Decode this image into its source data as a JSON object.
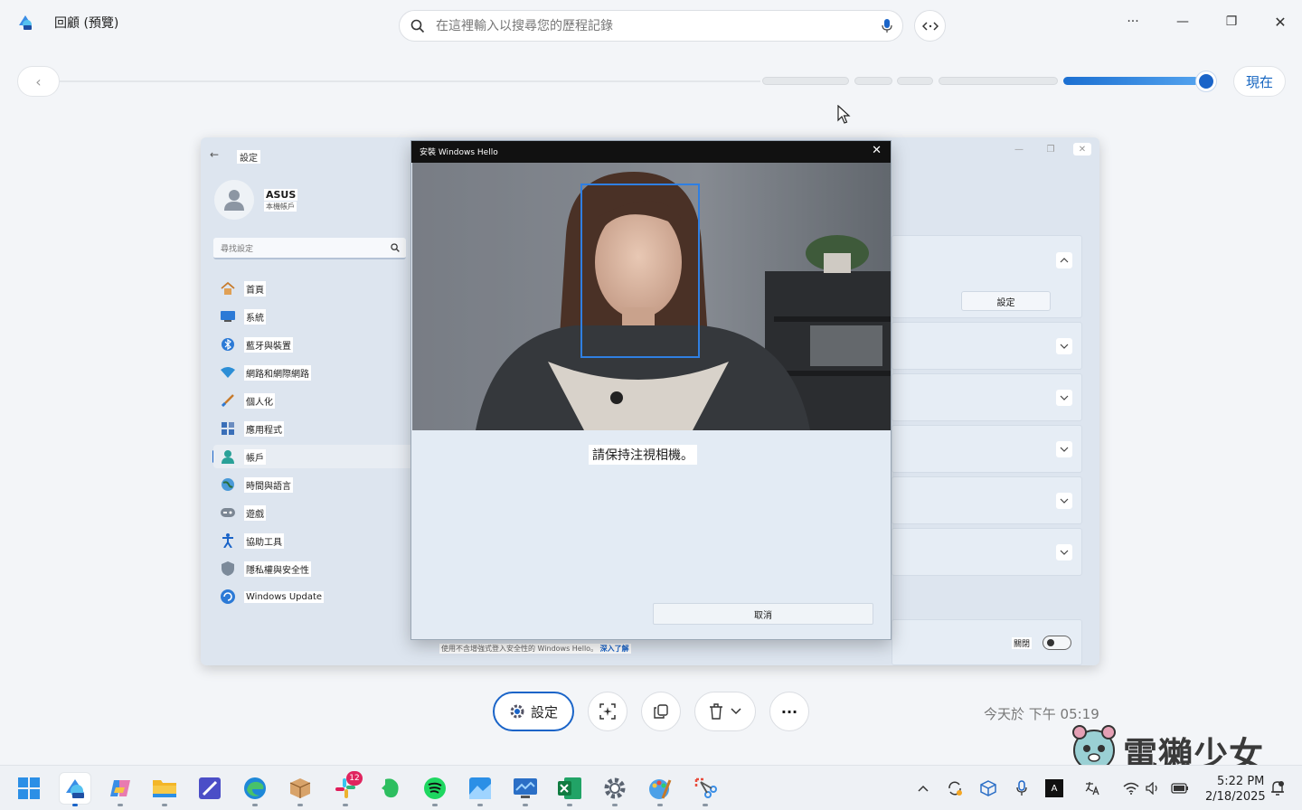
{
  "app": {
    "title": "回顧 (預覽)"
  },
  "search": {
    "placeholder": "在這裡輸入以搜尋您的歷程記錄"
  },
  "window": {
    "minimize": "—",
    "restore": "❐",
    "close": "✕",
    "more": "···"
  },
  "timeline": {
    "now_label": "現在",
    "back_label": "‹"
  },
  "snapshot": {
    "settings": {
      "back_arrow": "←",
      "title": "設定",
      "user_name": "ASUS",
      "user_role": "本機帳戶",
      "search_placeholder": "尋找設定",
      "nav": [
        {
          "label": "首頁",
          "icon": "home-icon"
        },
        {
          "label": "系統",
          "icon": "system-icon"
        },
        {
          "label": "藍牙與裝置",
          "icon": "bluetooth-icon"
        },
        {
          "label": "網路和網際網路",
          "icon": "wifi-icon"
        },
        {
          "label": "個人化",
          "icon": "brush-icon"
        },
        {
          "label": "應用程式",
          "icon": "apps-icon"
        },
        {
          "label": "帳戶",
          "icon": "account-icon"
        },
        {
          "label": "時間與語言",
          "icon": "globe-icon"
        },
        {
          "label": "遊戲",
          "icon": "gamepad-icon"
        },
        {
          "label": "協助工具",
          "icon": "accessibility-icon"
        },
        {
          "label": "隱私權與安全性",
          "icon": "shield-icon"
        },
        {
          "label": "Windows Update",
          "icon": "update-icon"
        }
      ],
      "setup_button": "設定",
      "toggle_label": "關閉",
      "footer_note": "使用不含增強式登入安全性的 Windows Hello。",
      "footer_link": "深入了解"
    },
    "hello_dialog": {
      "title": "安裝 Windows Hello",
      "close": "✕",
      "message": "請保持注視相機。",
      "cancel": "取消"
    }
  },
  "actions": {
    "settings_label": "設定",
    "more": "···"
  },
  "timestamp": "今天於 下午 05:19",
  "watermark": "電獺少女",
  "taskbar": {
    "badge_count": "12",
    "time": "5:22 PM",
    "date": "2/18/2025",
    "ime_label": "A"
  },
  "colors": {
    "accent": "#1a64c8",
    "timeline_active": "#2f7fe2",
    "face_box": "#2f7fe2"
  }
}
